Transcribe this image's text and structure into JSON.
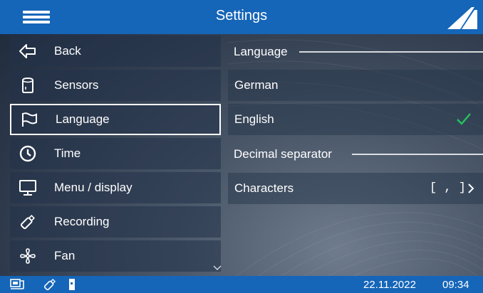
{
  "header": {
    "title": "Settings",
    "menu_icon": "hamburger-icon",
    "logo_icon": "brand-logo"
  },
  "sidebar": {
    "items": [
      {
        "label": "Back",
        "icon": "back-arrow-icon"
      },
      {
        "label": "Sensors",
        "icon": "sensor-icon"
      },
      {
        "label": "Language",
        "icon": "flag-icon",
        "selected": true
      },
      {
        "label": "Time",
        "icon": "clock-icon"
      },
      {
        "label": "Menu / display",
        "icon": "monitor-icon"
      },
      {
        "label": "Recording",
        "icon": "usb-stick-icon"
      },
      {
        "label": "Fan",
        "icon": "fan-icon"
      }
    ]
  },
  "main": {
    "language_section": {
      "heading": "Language",
      "options": [
        {
          "label": "German",
          "selected": false
        },
        {
          "label": "English",
          "selected": true
        }
      ]
    },
    "decimal_section": {
      "heading": "Decimal separator",
      "row_label": "Characters",
      "row_value": "[ , ]"
    }
  },
  "status_bar": {
    "date": "22.11.2022",
    "time": "09:34"
  },
  "colors": {
    "accent": "#1565b8",
    "check": "#22c55e",
    "text": "#ffffff"
  }
}
